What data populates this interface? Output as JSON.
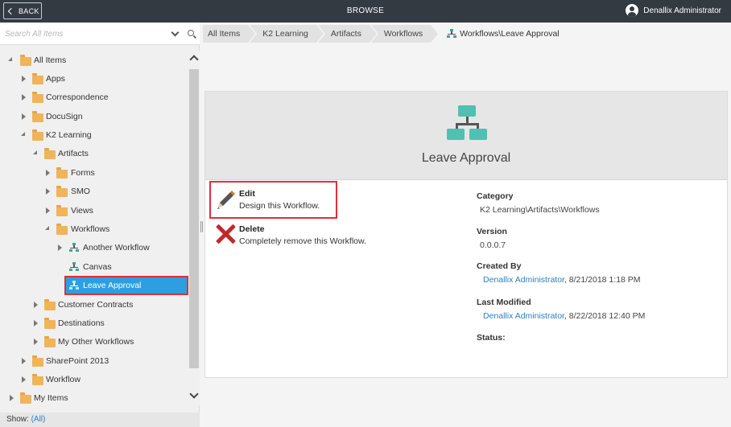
{
  "topbar": {
    "back_label": "BACK",
    "title": "BROWSE",
    "user_name": "Denallix Administrator"
  },
  "search": {
    "placeholder": "Search All Items"
  },
  "tree": {
    "all_items": "All Items",
    "apps": "Apps",
    "correspondence": "Correspondence",
    "docusign": "DocuSign",
    "k2_learning": "K2 Learning",
    "artifacts": "Artifacts",
    "forms": "Forms",
    "smo": "SMO",
    "views": "Views",
    "workflows": "Workflows",
    "another_workflow": "Another Workflow",
    "canvas": "Canvas",
    "leave_approval": "Leave Approval",
    "customer_contracts": "Customer Contracts",
    "destinations": "Destinations",
    "my_other_workflows": "My Other Workflows",
    "sharepoint_2013": "SharePoint 2013",
    "workflow": "Workflow",
    "my_items": "My Items"
  },
  "show": {
    "label": "Show:",
    "value": "(All)"
  },
  "breadcrumb": {
    "items": [
      "All Items",
      "K2 Learning",
      "Artifacts",
      "Workflows"
    ],
    "current": "Workflows\\Leave Approval"
  },
  "card": {
    "title": "Leave Approval",
    "edit_title": "Edit",
    "edit_desc": "Design this Workflow.",
    "delete_title": "Delete",
    "delete_desc": "Completely remove this Workflow.",
    "category_label": "Category",
    "category_value": "K2 Learning\\Artifacts\\Workflows",
    "version_label": "Version",
    "version_value": "0.0.0.7",
    "created_by_label": "Created By",
    "created_by_user": "Denallix Administrator",
    "created_by_date": ", 8/21/2018 1:18 PM",
    "modified_label": "Last Modified",
    "modified_user": "Denallix Administrator",
    "modified_date": ", 8/22/2018 12:40 PM",
    "status_label": "Status:"
  },
  "colors": {
    "topbar": "#333a42",
    "selection": "#2d9fe0",
    "highlight": "#e0303a",
    "workflow_icon": "#36a99b",
    "folder": "#f0b45a",
    "link": "#2d7fc1"
  }
}
